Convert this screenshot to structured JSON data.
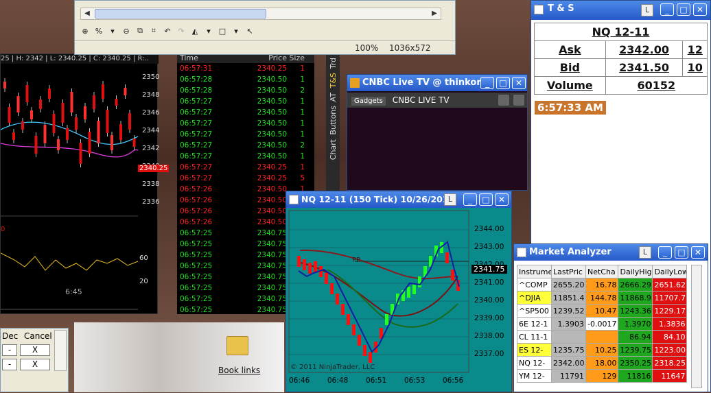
{
  "tool_window": {
    "zoom": "100%",
    "size": "1036x572",
    "zoom_combo": "%"
  },
  "ts_window": {
    "title": "T & S",
    "symbol": "NQ 12-11",
    "ask_label": "Ask",
    "ask_price": "2342.00",
    "ask_size": "12",
    "bid_label": "Bid",
    "bid_price": "2341.50",
    "bid_size": "10",
    "volume_label": "Volume",
    "volume": "60152",
    "time": "6:57:33 AM",
    "l_btn": "L"
  },
  "left_chart": {
    "header": "25 | H: 2342 | L: 2340.25 | C: 2340.25 | R:..",
    "price_labels": [
      "2350",
      "2348",
      "2346",
      "2344",
      "2342",
      "2340",
      "2338",
      "2336"
    ],
    "last_price": "2340.25",
    "osc_labels": [
      "60",
      "20"
    ],
    "osc_marker": "0",
    "time_label": "6:45"
  },
  "ts_grid": {
    "headers": [
      "Time",
      "Price",
      "Size"
    ],
    "rows": [
      {
        "t": "06:57:31",
        "p": "2340.25",
        "s": "1",
        "c": "red"
      },
      {
        "t": "06:57:28",
        "p": "2340.50",
        "s": "1",
        "c": "green"
      },
      {
        "t": "06:57:28",
        "p": "2340.50",
        "s": "2",
        "c": "green"
      },
      {
        "t": "06:57:27",
        "p": "2340.50",
        "s": "1",
        "c": "green"
      },
      {
        "t": "06:57:27",
        "p": "2340.50",
        "s": "1",
        "c": "green"
      },
      {
        "t": "06:57:27",
        "p": "2340.50",
        "s": "1",
        "c": "green"
      },
      {
        "t": "06:57:27",
        "p": "2340.50",
        "s": "1",
        "c": "green"
      },
      {
        "t": "06:57:27",
        "p": "2340.50",
        "s": "2",
        "c": "green"
      },
      {
        "t": "06:57:27",
        "p": "2340.50",
        "s": "1",
        "c": "green"
      },
      {
        "t": "06:57:27",
        "p": "2340.25",
        "s": "1",
        "c": "red"
      },
      {
        "t": "06:57:27",
        "p": "2340.25",
        "s": "5",
        "c": "red"
      },
      {
        "t": "06:57:26",
        "p": "2340.50",
        "s": "1",
        "c": "red"
      },
      {
        "t": "06:57:26",
        "p": "2340.50",
        "s": "1",
        "c": "red"
      },
      {
        "t": "06:57:26",
        "p": "2340.50",
        "s": "1",
        "c": "red"
      },
      {
        "t": "06:57:26",
        "p": "2340.50",
        "s": "1",
        "c": "red"
      },
      {
        "t": "06:57:25",
        "p": "2340.75",
        "s": "1",
        "c": "green"
      },
      {
        "t": "06:57:25",
        "p": "2340.75",
        "s": "1",
        "c": "green"
      },
      {
        "t": "06:57:25",
        "p": "2340.75",
        "s": "1",
        "c": "green"
      },
      {
        "t": "06:57:25",
        "p": "2340.75",
        "s": "1",
        "c": "green"
      },
      {
        "t": "06:57:25",
        "p": "2340.75",
        "s": "1",
        "c": "green"
      },
      {
        "t": "06:57:25",
        "p": "2340.75",
        "s": "1",
        "c": "green"
      },
      {
        "t": "06:57:25",
        "p": "2340.75",
        "s": "1",
        "c": "green"
      },
      {
        "t": "06:57:25",
        "p": "2340.75",
        "s": "1",
        "c": "green"
      }
    ]
  },
  "side_tabs": [
    "Trd",
    "T&S",
    "AT",
    "Buttons",
    "Chart"
  ],
  "cnbc": {
    "title": "CNBC Live TV @ thinkor...",
    "tab_label": "Gadgets",
    "channel": "CNBC LIVE TV"
  },
  "nq_chart": {
    "title": "NQ 12-11 (150 Tick)  10/26/2011",
    "l_btn": "L",
    "price_labels": [
      "2344.00",
      "2343.00",
      "2342.00",
      "2341.00",
      "2340.00",
      "2339.00",
      "2338.00",
      "2337.00"
    ],
    "last_price": "2341.75",
    "pp_label": "PP",
    "time_labels": [
      "06:46",
      "06:48",
      "06:51",
      "06:53",
      "06:56"
    ],
    "copyright": "© 2011 NinjaTrader, LLC"
  },
  "market_analyzer": {
    "title": "Market Analyzer",
    "l_btn": "L",
    "headers": [
      "Instrume",
      "LastPric",
      "NetCha",
      "DailyHig",
      "DailyLow"
    ],
    "rows": [
      {
        "cells": [
          "^COMP",
          "2655.20",
          "16.78",
          "2666.29",
          "2651.62"
        ],
        "cls": [
          "wht",
          "gray",
          "org",
          "grn",
          "red"
        ]
      },
      {
        "cells": [
          "^DJIA",
          "11851.4",
          "144.78",
          "11868.9",
          "11707.7"
        ],
        "cls": [
          "yel",
          "gray",
          "org",
          "grn",
          "red"
        ]
      },
      {
        "cells": [
          "^SP500",
          "1239.52",
          "10.47",
          "1243.36",
          "1229.17"
        ],
        "cls": [
          "wht",
          "gray",
          "org",
          "grn",
          "red"
        ]
      },
      {
        "cells": [
          "6E 12-1",
          "1.3903",
          "-0.0017",
          "1.3970",
          "1.3836"
        ],
        "cls": [
          "wht",
          "gray",
          "wht",
          "grn",
          "red"
        ]
      },
      {
        "cells": [
          "CL 11-1",
          "",
          "",
          "86.94",
          "84.10"
        ],
        "cls": [
          "wht",
          "gray",
          "org",
          "grn",
          "red"
        ]
      },
      {
        "cells": [
          "ES 12-",
          "1235.75",
          "10.25",
          "1239.75",
          "1223.00"
        ],
        "cls": [
          "yel",
          "gray",
          "org",
          "grn",
          "red"
        ]
      },
      {
        "cells": [
          "NQ 12-",
          "2342.00",
          "18.00",
          "2350.25",
          "2318.25"
        ],
        "cls": [
          "wht",
          "gray",
          "org",
          "grn",
          "red"
        ]
      },
      {
        "cells": [
          "YM 12-",
          "11791",
          "129",
          "11816",
          "11647"
        ],
        "cls": [
          "wht",
          "gray",
          "org",
          "grn",
          "red"
        ]
      }
    ]
  },
  "order_panel": {
    "dec": "Dec",
    "cancel": "Cancel",
    "minus": "-",
    "x": "X"
  },
  "desktop": {
    "book_links": "Book links"
  }
}
